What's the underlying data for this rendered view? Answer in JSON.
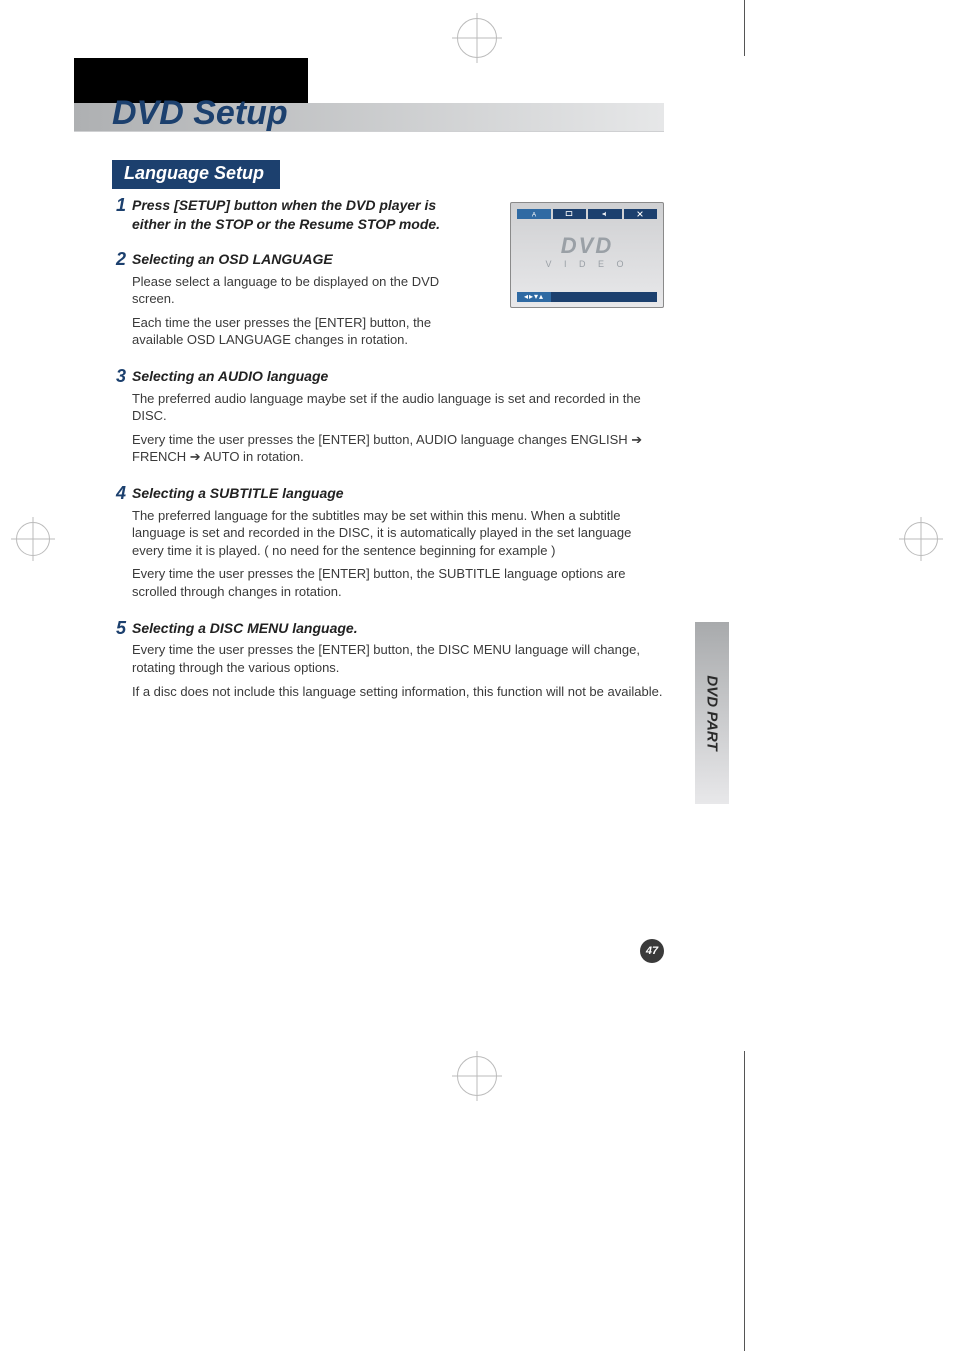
{
  "title": "DVD Setup",
  "section_label": "Language Setup",
  "side_tab": "DVD PART",
  "page_number": "47",
  "thumb": {
    "logo": "DVD",
    "video": "V I D E O",
    "arrows": "◂▸▾▴"
  },
  "steps": [
    {
      "n": "1",
      "head": "Press [SETUP] button when the DVD player is either in the STOP or the Resume STOP mode.",
      "paras": []
    },
    {
      "n": "2",
      "head": "Selecting an OSD LANGUAGE",
      "paras": [
        "Please select a language to be displayed on the DVD screen.",
        "Each time the user presses the [ENTER] button, the available OSD LANGUAGE changes in rotation."
      ]
    },
    {
      "n": "3",
      "head": "Selecting an AUDIO language",
      "paras": [
        "The preferred audio language maybe set if the audio language is set and recorded in the DISC.",
        "Every time the user presses the [ENTER] button, AUDIO language changes ENGLISH ➔ FRENCH ➔ AUTO in rotation."
      ]
    },
    {
      "n": "4",
      "head": "Selecting a SUBTITLE language",
      "paras": [
        "The preferred language for the subtitles may be set within this menu. When a subtitle language is set and recorded in the DISC, it is automatically played in the set language every time it is played. ( no need for the sentence beginning for example )",
        "Every time the user presses the [ENTER] button, the SUBTITLE language options are scrolled through changes in rotation."
      ]
    },
    {
      "n": "5",
      "head": "Selecting a DISC MENU language.",
      "paras": [
        "Every time the user presses the [ENTER] button, the DISC MENU language will change, rotating through the various options.",
        "If a disc does not include this language setting information, this function will not be available."
      ]
    }
  ]
}
